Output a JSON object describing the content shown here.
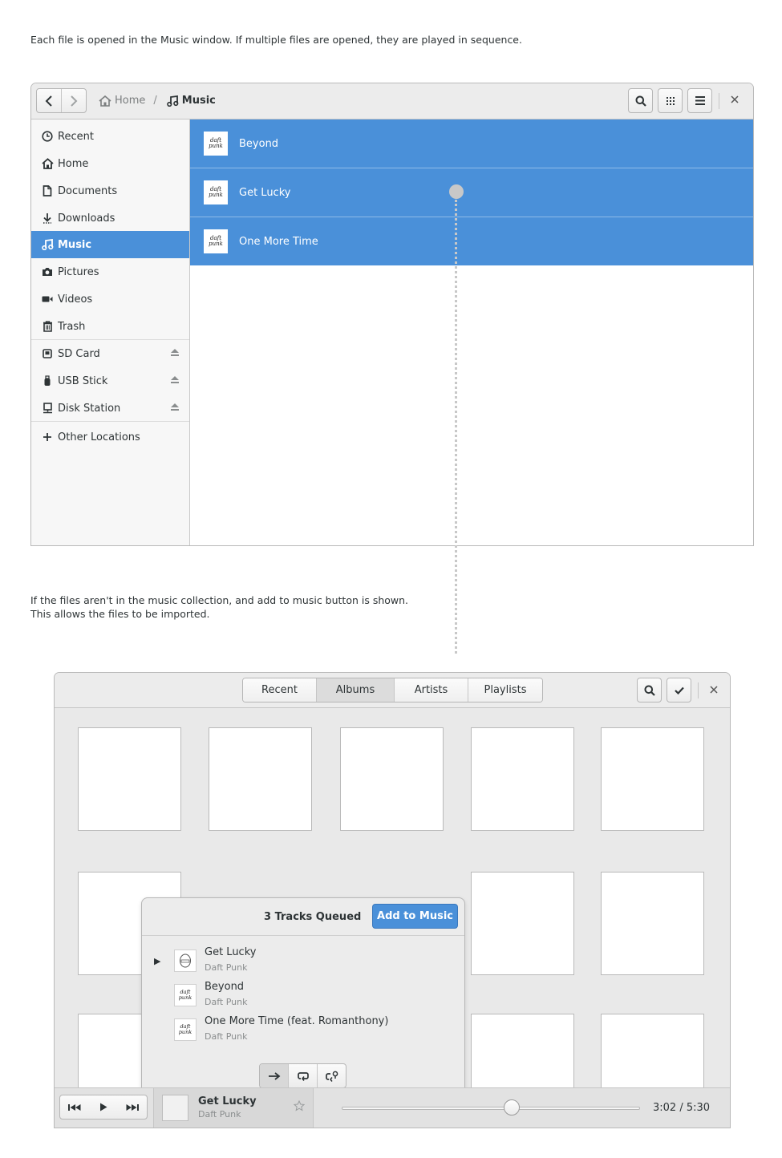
{
  "notes": {
    "top": "Each file is opened in the Music window. If multiple files are opened, they are played in sequence.",
    "middle_line1": "If the files aren't in the music collection, and add to music button is shown.",
    "middle_line2": "This allows the files to be imported."
  },
  "files": {
    "breadcrumb": {
      "home": "Home",
      "separator": "/",
      "current": "Music"
    },
    "sidebar": [
      {
        "label": "Recent",
        "icon": "clock-icon"
      },
      {
        "label": "Home",
        "icon": "home-icon"
      },
      {
        "label": "Documents",
        "icon": "document-icon"
      },
      {
        "label": "Downloads",
        "icon": "download-icon"
      },
      {
        "label": "Music",
        "icon": "music-icon",
        "active": true
      },
      {
        "label": "Pictures",
        "icon": "camera-icon"
      },
      {
        "label": "Videos",
        "icon": "video-icon"
      },
      {
        "label": "Trash",
        "icon": "trash-icon"
      },
      {
        "label": "SD Card",
        "icon": "sd-card-icon",
        "eject": true
      },
      {
        "label": "USB Stick",
        "icon": "usb-icon",
        "eject": true
      },
      {
        "label": "Disk Station",
        "icon": "network-drive-icon",
        "eject": true
      },
      {
        "label": "Other Locations",
        "icon": "plus-icon"
      }
    ],
    "rows": [
      {
        "name": "Beyond",
        "thumb_text": "daft punk"
      },
      {
        "name": "Get Lucky",
        "thumb_text": "daft punk"
      },
      {
        "name": "One More Time",
        "thumb_text": "daft punk"
      }
    ],
    "selection_color": "#4a90d9"
  },
  "music": {
    "tabs": [
      "Recent",
      "Albums",
      "Artists",
      "Playlists"
    ],
    "active_tab": "Albums",
    "popover": {
      "title": "3 Tracks Queued",
      "add_button": "Add to Music",
      "tracks": [
        {
          "title": "Get Lucky",
          "artist": "Daft Punk",
          "playing": true
        },
        {
          "title": "Beyond",
          "artist": "Daft Punk",
          "playing": false
        },
        {
          "title": "One More Time (feat. Romanthony)",
          "artist": "Daft Punk",
          "playing": false
        }
      ],
      "repeat_modes": [
        "no-repeat-icon",
        "repeat-icon",
        "shuffle-repeat-icon"
      ],
      "active_repeat_mode": "no-repeat-icon"
    },
    "now_playing": {
      "title": "Get Lucky",
      "artist": "Daft Punk",
      "time": "3:02 / 5:30",
      "progress": 0.57
    },
    "accent_color": "#4a90d9"
  }
}
